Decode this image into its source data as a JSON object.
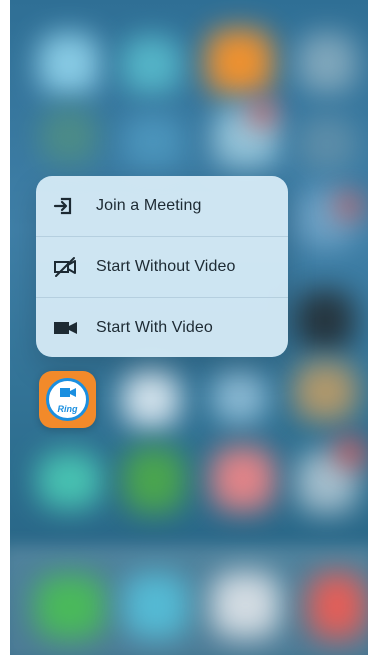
{
  "contextMenu": {
    "items": [
      {
        "label": "Join a Meeting",
        "icon": "join-meeting-icon"
      },
      {
        "label": "Start Without Video",
        "icon": "video-off-icon"
      },
      {
        "label": "Start With Video",
        "icon": "video-camera-icon"
      }
    ]
  },
  "appIcon": {
    "label": "Ring",
    "icon": "video-camera-app-icon"
  },
  "colors": {
    "menuBackground": "#DAEEF8",
    "appOrange": "#F28A2A",
    "appBlue": "#1A8FE0"
  }
}
